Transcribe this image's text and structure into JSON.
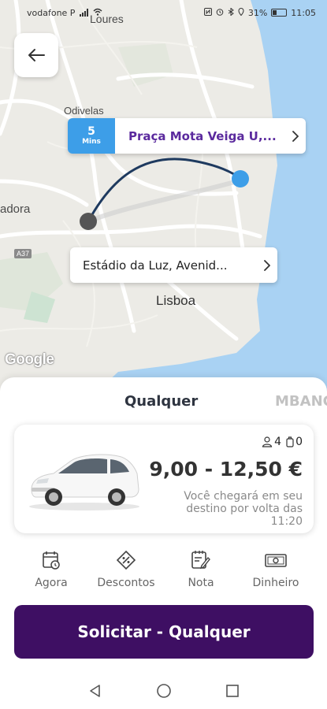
{
  "status_bar": {
    "carrier": "vodafone P",
    "battery": "31%",
    "time": "11:05"
  },
  "map": {
    "labels": {
      "loures": "Loures",
      "odivelas": "Odivelas",
      "amadora": "adora",
      "lisboa": "Lisboa",
      "a37": "A37"
    },
    "provider": "Google",
    "route_color": "#1e3a5f",
    "destination_marker_color": "#3d9ee8",
    "origin_marker_color": "#555555"
  },
  "destination": {
    "eta_value": "5",
    "eta_unit": "Mins",
    "address": "Praça Mota Veiga U,..."
  },
  "origin": {
    "address": "Estádio da Luz, Avenid..."
  },
  "tabs": [
    {
      "label": "Qualquer",
      "active": true
    },
    {
      "label": "MBANC",
      "active": false
    }
  ],
  "ride_card": {
    "passengers": "4",
    "luggage": "0",
    "price": "9,00 - 12,50 €",
    "arrival_text": "Você chegará em seu destino por volta das 11:20"
  },
  "options": [
    {
      "label": "Agora",
      "icon": "calendar-clock-icon"
    },
    {
      "label": "Descontos",
      "icon": "discount-icon"
    },
    {
      "label": "Nota",
      "icon": "note-icon"
    },
    {
      "label": "Dinheiro",
      "icon": "cash-icon"
    }
  ],
  "request_button": {
    "label": "Solicitar - Qualquer"
  },
  "colors": {
    "primary": "#3e0f63",
    "accent": "#5b2a9e",
    "eta_blue": "#3d9ee8"
  }
}
